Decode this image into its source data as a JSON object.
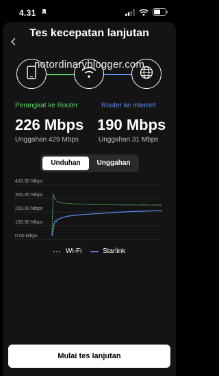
{
  "status": {
    "time": "4.31"
  },
  "header": {
    "title": "Tes kecepatan lanjutan"
  },
  "watermark": "notordinaryblogger.com",
  "path": {
    "left_label": "Perangkat ke Router",
    "right_label": "Router ke internet",
    "left_color": "#5fd36b",
    "right_color": "#5b8df5",
    "nodes": [
      "phone-icon",
      "wifi-router-icon",
      "globe-icon"
    ]
  },
  "results": {
    "left_speed": "226 Mbps",
    "left_upload": "Unggahan 429 Mbps",
    "right_speed": "190 Mbps",
    "right_upload": "Unggahan 31 Mbps"
  },
  "tabs": {
    "download": "Unduhan",
    "upload": "Unggahan",
    "selected": "Unduhan"
  },
  "chart_data": {
    "type": "line",
    "title": "",
    "xlabel": "",
    "ylabel": "",
    "ylim": [
      0,
      400
    ],
    "yticks": [
      "400.00 Mbps",
      "300.00 Mbps",
      "200.00 Mbps",
      "100.00 Mbps",
      "0.00 Mbps"
    ],
    "grid": true,
    "legend_position": "bottom",
    "series": [
      {
        "name": "Wi-Fi",
        "style": "dashed",
        "color": "#5fd36b",
        "x": [
          0,
          1,
          2,
          3,
          4,
          5,
          6,
          8,
          10,
          14,
          20,
          30,
          45,
          60,
          80,
          100
        ],
        "values": [
          15,
          315,
          290,
          275,
          262,
          255,
          250,
          247,
          245,
          243,
          238,
          235,
          233,
          232,
          231,
          230
        ]
      },
      {
        "name": "Starlink",
        "style": "solid",
        "color": "#5b8df5",
        "x": [
          0,
          1,
          2,
          3,
          4,
          5,
          6,
          8,
          10,
          14,
          20,
          30,
          45,
          60,
          80,
          100
        ],
        "values": [
          5,
          45,
          95,
          115,
          108,
          130,
          125,
          135,
          140,
          148,
          155,
          162,
          170,
          178,
          185,
          190
        ]
      }
    ]
  },
  "action": {
    "start_label": "Mulai tes lanjutan"
  }
}
